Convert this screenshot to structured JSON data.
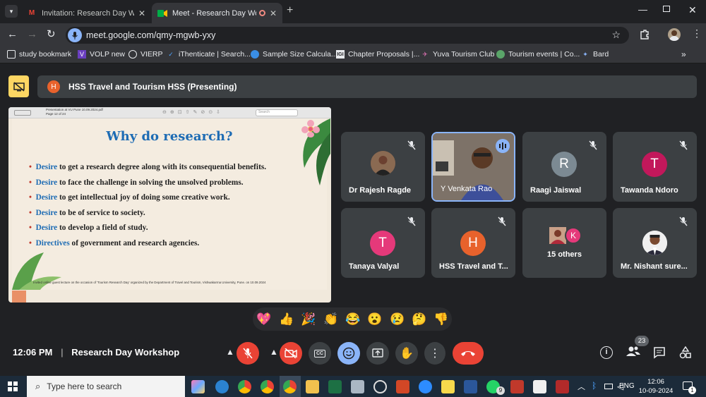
{
  "tabs": [
    {
      "title": "Invitation: Research Day Worksh",
      "icon": "gmail-icon"
    },
    {
      "title": "Meet - Research Day Works",
      "icon": "meet-icon"
    }
  ],
  "address": {
    "url": "meet.google.com/qmy-mgwb-yxy"
  },
  "bookmarks": [
    {
      "label": "study bookmark"
    },
    {
      "label": "VOLP new"
    },
    {
      "label": "VIERP"
    },
    {
      "label": "iThenticate | Search..."
    },
    {
      "label": "Sample Size Calcula..."
    },
    {
      "label": "Chapter Proposals |..."
    },
    {
      "label": "Yuva Tourism Club"
    },
    {
      "label": "Tourism events | Co..."
    },
    {
      "label": "Bard"
    }
  ],
  "presenter": {
    "initial": "H",
    "text": "HSS Travel and Tourism HSS (Presenting)"
  },
  "slide": {
    "pdf_title": "Presentation at VU Pune 10.09.2024.pdf",
    "pdf_page": "Page 12 of 24",
    "search_placeholder": "Search",
    "title": "Why do research?",
    "bullets": [
      {
        "key": "Desire",
        "rest": " to get a research degree along with its consequential benefits."
      },
      {
        "key": "Desire",
        "rest": " to face the challenge in solving the unsolved problems."
      },
      {
        "key": "Desire",
        "rest": " to get intellectual joy of doing some creative work."
      },
      {
        "key": "Desire",
        "rest": " to be of service to society."
      },
      {
        "key": "Desire",
        "rest": " to develop a field of study."
      },
      {
        "key": "Directives",
        "rest": " of government and research agencies."
      }
    ],
    "footer": "Invited online guest lecture on the occasion of 'Tourism Research Day' organized by the Department of Travel and Tourism, Vishwakarma University, Pune. on 10.09.2024"
  },
  "participants": [
    {
      "name": "Dr Rajesh Ragde"
    },
    {
      "name": "Y Venkata Rao"
    },
    {
      "name": "Raagi Jaiswal",
      "initial": "R"
    },
    {
      "name": "Tawanda Ndoro",
      "initial": "T"
    },
    {
      "name": "Tanaya Valyal",
      "initial": "T"
    },
    {
      "name": "HSS Travel and T...",
      "initial": "H"
    },
    {
      "name": "15 others",
      "initial": "K"
    },
    {
      "name": "Mr. Nishant sure..."
    }
  ],
  "reactions": [
    "💖",
    "👍",
    "🎉",
    "👏",
    "😂",
    "😮",
    "😢",
    "🤔",
    "👎"
  ],
  "bottom": {
    "time": "12:06 PM",
    "meeting": "Research Day Workshop",
    "people_count": "23"
  },
  "taskbar": {
    "search_placeholder": "Type here to search",
    "lang": "ENG",
    "time": "12:06",
    "date": "10-09-2024",
    "whatsapp_badge": "9",
    "notif_badge": "1"
  },
  "colors": {
    "accent_blue": "#8ab4f8",
    "end_call": "#ea4335",
    "presenting_yellow": "#fdd663",
    "slide_blue": "#1e6cb4"
  }
}
